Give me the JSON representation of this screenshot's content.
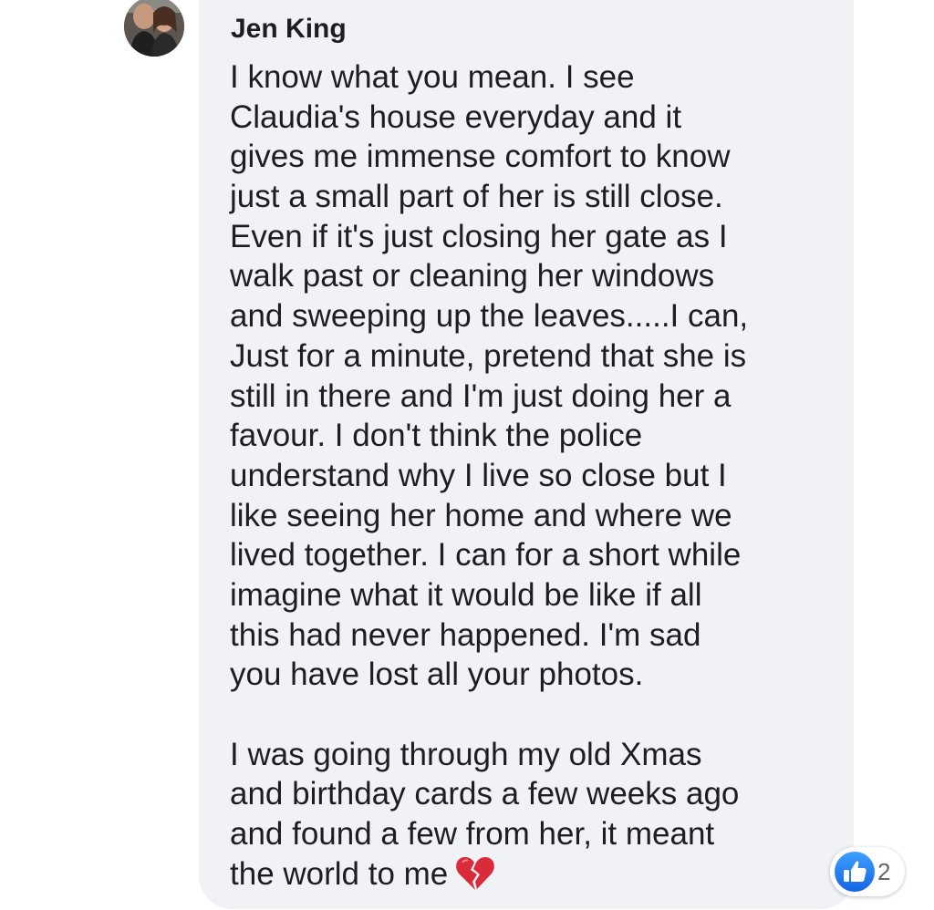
{
  "comment": {
    "author": "Jen King",
    "paragraph1_lines": [
      "I know what you mean. I see",
      "Claudia's house everyday and it",
      "gives me immense comfort to know",
      "just a small part of her is still close.",
      "Even if it's just closing her gate as I",
      "walk past or cleaning her windows",
      "and sweeping up the leaves.....I can,",
      "Just for a minute, pretend that she is",
      "still in there and I'm just doing her a",
      "favour. I don't think the police",
      "understand why I live so close but I",
      "like seeing her home and where we",
      "lived together. I can for a short while",
      "imagine what it would be like if all",
      "this had never happened. I'm sad",
      "you have lost all your photos."
    ],
    "paragraph2_lines": [
      "I was going through my old Xmas",
      "and birthday cards a few weeks ago",
      "and found a few from her, it meant",
      "the world to me"
    ],
    "emoji": "broken-heart-icon",
    "reactions": {
      "icon": "like-icon",
      "count": "2"
    }
  },
  "colors": {
    "bubble": "#f0f2f5",
    "text": "#1c1e21",
    "like_blue": "#1877f2",
    "heart_red": "#d92b3a"
  }
}
